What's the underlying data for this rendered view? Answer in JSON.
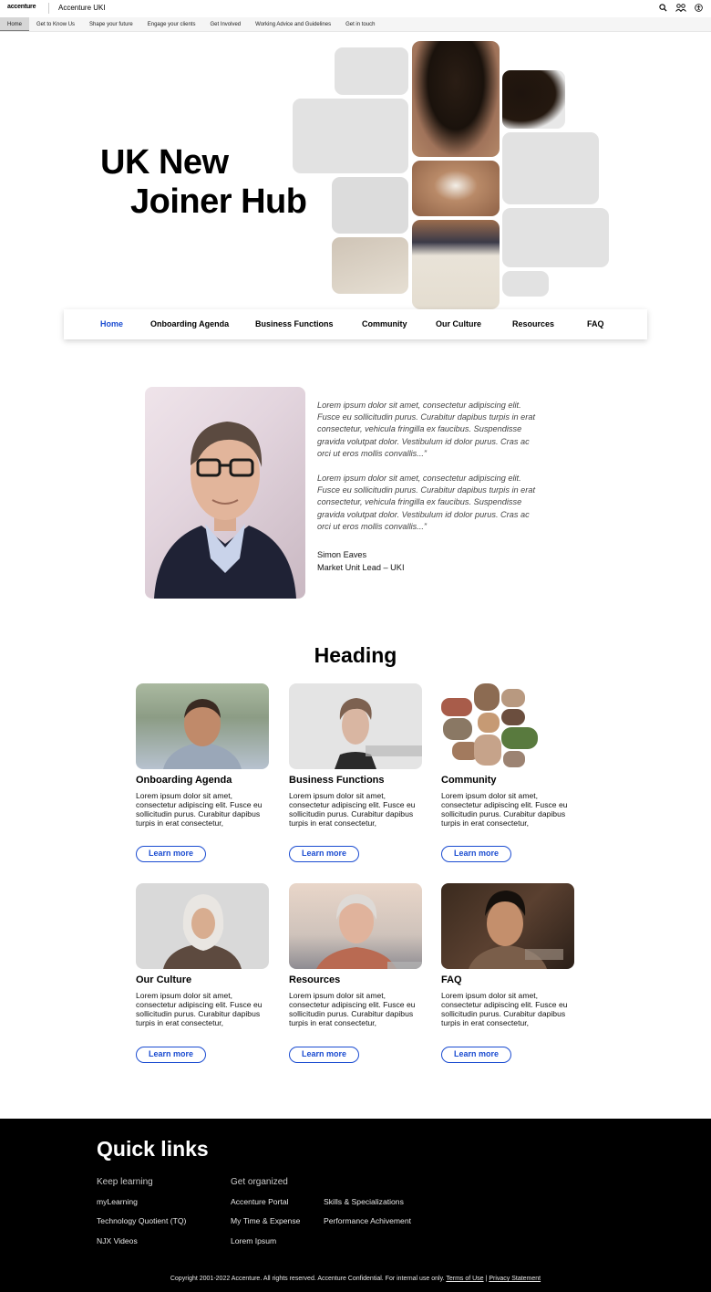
{
  "app": {
    "logo": "accenture",
    "site_name": "Accenture UKI"
  },
  "top_icons": [
    "search-icon",
    "people-icon",
    "accessibility-icon"
  ],
  "subnav": {
    "items": [
      "Home",
      "Get to Know Us",
      "Shape your future",
      "Engage your clients",
      "Get Involved",
      "Working Advice and Guidelines",
      "Get in touch"
    ],
    "active": "Home"
  },
  "hero": {
    "title_line1": "UK New",
    "title_line2": "Joiner Hub"
  },
  "menu": {
    "items": [
      "Home",
      "Onboarding Agenda",
      "Business Functions",
      "Community",
      "Our Culture",
      "Resources",
      "FAQ"
    ],
    "active": "Home",
    "accent_color": "#1b4cd1"
  },
  "quote": {
    "paragraph1": "Lorem ipsum dolor sit amet, consectetur adipiscing elit. Fusce eu sollicitudin purus. Curabitur dapibus turpis in erat consectetur, vehicula fringilla ex faucibus. Suspendisse gravida volutpat dolor. Vestibulum id dolor purus. Cras ac orci ut eros mollis convallis...”",
    "paragraph2": "Lorem ipsum dolor sit amet, consectetur adipiscing elit. Fusce eu sollicitudin purus. Curabitur dapibus turpis in erat consectetur, vehicula fringilla ex faucibus. Suspendisse gravida volutpat dolor. Vestibulum id dolor purus. Cras ac orci ut eros mollis convallis...”",
    "name": "Simon Eaves",
    "role": "Market Unit Lead – UKI"
  },
  "cards_section": {
    "heading": "Heading",
    "learn_more": "Learn more",
    "cards": [
      {
        "title": "Onboarding Agenda",
        "text": "Lorem ipsum dolor sit amet, consectetur adipiscing elit. Fusce eu sollicitudin purus. Curabitur dapibus turpis in erat consectetur,"
      },
      {
        "title": "Business Functions",
        "text": "Lorem ipsum dolor sit amet, consectetur adipiscing elit. Fusce eu sollicitudin purus. Curabitur dapibus turpis in erat consectetur,"
      },
      {
        "title": "Community",
        "text": "Lorem ipsum dolor sit amet, consectetur adipiscing elit. Fusce eu sollicitudin purus. Curabitur dapibus turpis in erat consectetur,"
      },
      {
        "title": "Our Culture",
        "text": "Lorem ipsum dolor sit amet, consectetur adipiscing elit. Fusce eu sollicitudin purus. Curabitur dapibus turpis in erat consectetur,"
      },
      {
        "title": "Resources",
        "text": "Lorem ipsum dolor sit amet, consectetur adipiscing elit. Fusce eu sollicitudin purus. Curabitur dapibus turpis in erat consectetur,"
      },
      {
        "title": "FAQ",
        "text": "Lorem ipsum dolor sit amet, consectetur adipiscing elit. Fusce eu sollicitudin purus. Curabitur dapibus turpis in erat consectetur,"
      }
    ]
  },
  "footer": {
    "title": "Quick links",
    "col1_heading": "Keep learning",
    "col1_links": [
      "myLearning",
      "Technology Quotient (TQ)",
      "NJX Videos"
    ],
    "col2_heading": "Get organized",
    "col2_links": [
      "Accenture Portal",
      "My Time & Expense",
      "Lorem Ipsum"
    ],
    "col3_links": [
      "Skills & Specializations",
      "Performance Achivement"
    ],
    "copyright": "Copyright 2001-2022 Accenture. All rights reserved. Accenture Confidential. For internal use only.",
    "terms": "Terms of Use",
    "separator": "|",
    "privacy": "Privacy Statement"
  }
}
